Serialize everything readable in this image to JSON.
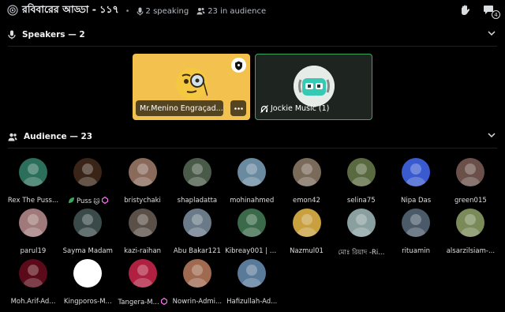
{
  "header": {
    "title": "রবিবারের আড্ডা - ১১৭",
    "speaking": "2 speaking",
    "audience": "23 in audience",
    "notification_count": "4"
  },
  "speakers_section": {
    "label": "Speakers — 2"
  },
  "speakers": [
    {
      "name": "Mr.Menino Engraçad...",
      "avatar_color": "#f2c14e"
    },
    {
      "name": "Jockie Music (1)",
      "avatar_color": "#1e2420"
    }
  ],
  "audience_section": {
    "label": "Audience — 23"
  },
  "audience": [
    {
      "name": "Rex The Puss...",
      "color": "#2b6e5a"
    },
    {
      "name": "Puss",
      "color": "#3a2418",
      "emoji": "🐱"
    },
    {
      "name": "bristychaki",
      "color": "#8a6a5a"
    },
    {
      "name": "shapladatta",
      "color": "#4a5a48"
    },
    {
      "name": "mohinahmed",
      "color": "#6a8aa0"
    },
    {
      "name": "emon42",
      "color": "#7a6a5a"
    },
    {
      "name": "selina75",
      "color": "#5a6a40"
    },
    {
      "name": "Nipa Das",
      "color": "#3a5ad0"
    },
    {
      "name": "green015",
      "color": "#6a5048"
    },
    {
      "name": "parul19",
      "color": "#a07a7a"
    },
    {
      "name": "Sayma Madam",
      "color": "#3a4a48"
    },
    {
      "name": "kazi-raihan",
      "color": "#5a5048"
    },
    {
      "name": "Abu Bakar121",
      "color": "#6a7a88"
    },
    {
      "name": "Kibreay001 | $...",
      "color": "#3a6a4a"
    },
    {
      "name": "Nazmul01",
      "color": "#c8a040"
    },
    {
      "name": "মোঃ রিয়াদ -Ri...",
      "color": "#8aa0a0"
    },
    {
      "name": "rituamin",
      "color": "#4a5a68"
    },
    {
      "name": "alsarzilsiam-...",
      "color": "#7a8a58"
    },
    {
      "name": "Moh.Arif-Ad...",
      "color": "#5a0a18"
    },
    {
      "name": "Kingporos-M...",
      "color": "#ffffff"
    },
    {
      "name": "Tangera-M...",
      "color": "#b02040"
    },
    {
      "name": "Nowrin-Admi...",
      "color": "#a06a50"
    },
    {
      "name": "Hafizullah-Ad...",
      "color": "#5a7a9a"
    }
  ],
  "colors": {
    "accent_green": "#3ba55d",
    "speaker_yellow": "#f2c14e",
    "background": "#000000"
  }
}
